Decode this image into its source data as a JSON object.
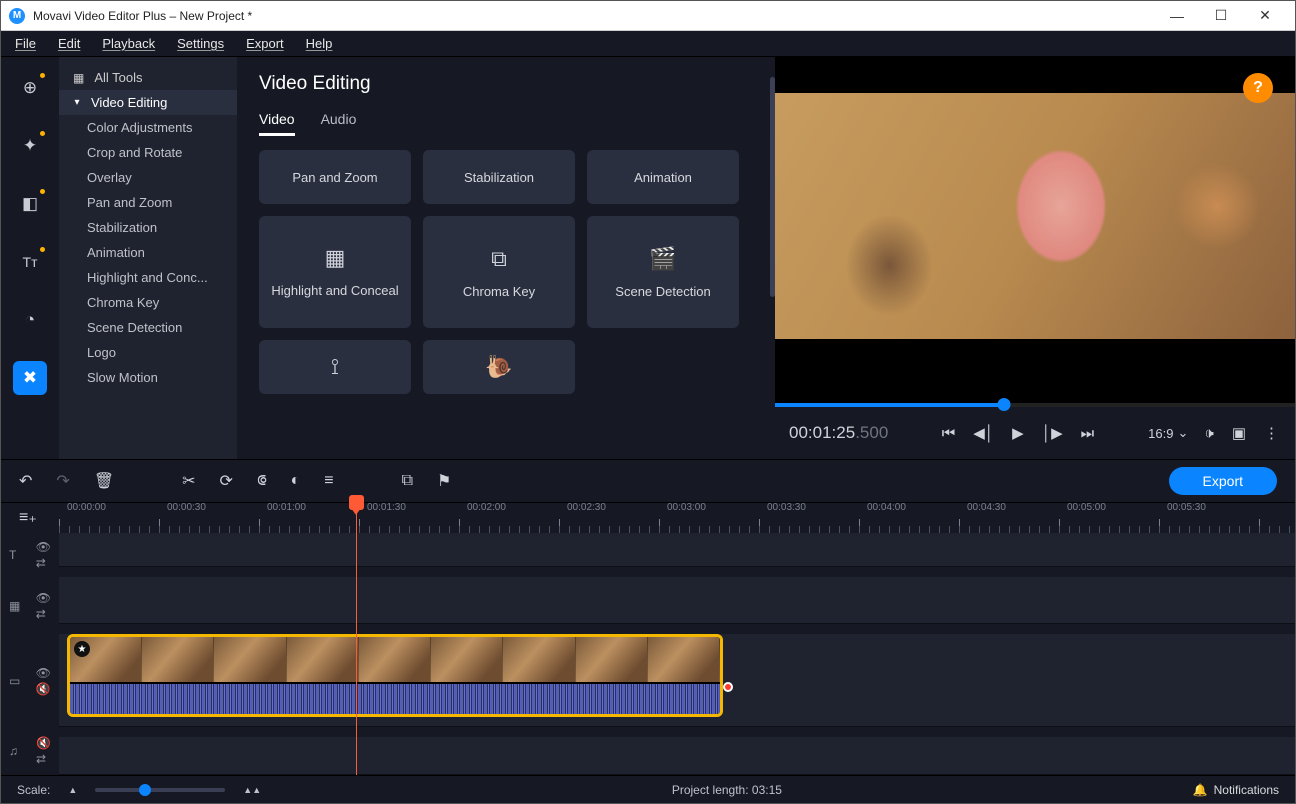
{
  "titlebar": {
    "title": "Movavi Video Editor Plus – New Project *"
  },
  "menu": {
    "items": [
      "File",
      "Edit",
      "Playback",
      "Settings",
      "Export",
      "Help"
    ]
  },
  "rail": {
    "icons": [
      "add",
      "wand",
      "panel",
      "text",
      "moon",
      "tools"
    ]
  },
  "sidebar": {
    "root": {
      "label": "All Tools"
    },
    "active": {
      "label": "Video Editing"
    },
    "sub": [
      "Color Adjustments",
      "Crop and Rotate",
      "Overlay",
      "Pan and Zoom",
      "Stabilization",
      "Animation",
      "Highlight and Conc...",
      "Chroma Key",
      "Scene Detection",
      "Logo",
      "Slow Motion"
    ]
  },
  "center": {
    "title": "Video Editing",
    "tabs": [
      "Video",
      "Audio"
    ],
    "active_tab": 0,
    "cards_row1": [
      "Pan and Zoom",
      "Stabilization",
      "Animation"
    ],
    "cards_row2": [
      {
        "label": "Highlight and Conceal",
        "icon": "▦"
      },
      {
        "label": "Chroma Key",
        "icon": "⧉"
      },
      {
        "label": "Scene Detection",
        "icon": "🎬"
      }
    ],
    "cards_row3_icons": [
      "⟟",
      "🐌"
    ]
  },
  "preview": {
    "time_main": "00:01:25",
    "time_ms": ".500",
    "progress_pct": 44,
    "aspect": "16:9"
  },
  "toolbar": {
    "export": "Export"
  },
  "ruler": {
    "labels": [
      "00:00:00",
      "00:00:30",
      "00:01:00",
      "00:01:30",
      "00:02:00",
      "00:02:30",
      "00:03:00",
      "00:03:30",
      "00:04:00",
      "00:04:30",
      "00:05:00",
      "00:05:30"
    ]
  },
  "status": {
    "scale": "Scale:",
    "project_length": "Project length:  03:15",
    "notifications": "Notifications"
  }
}
